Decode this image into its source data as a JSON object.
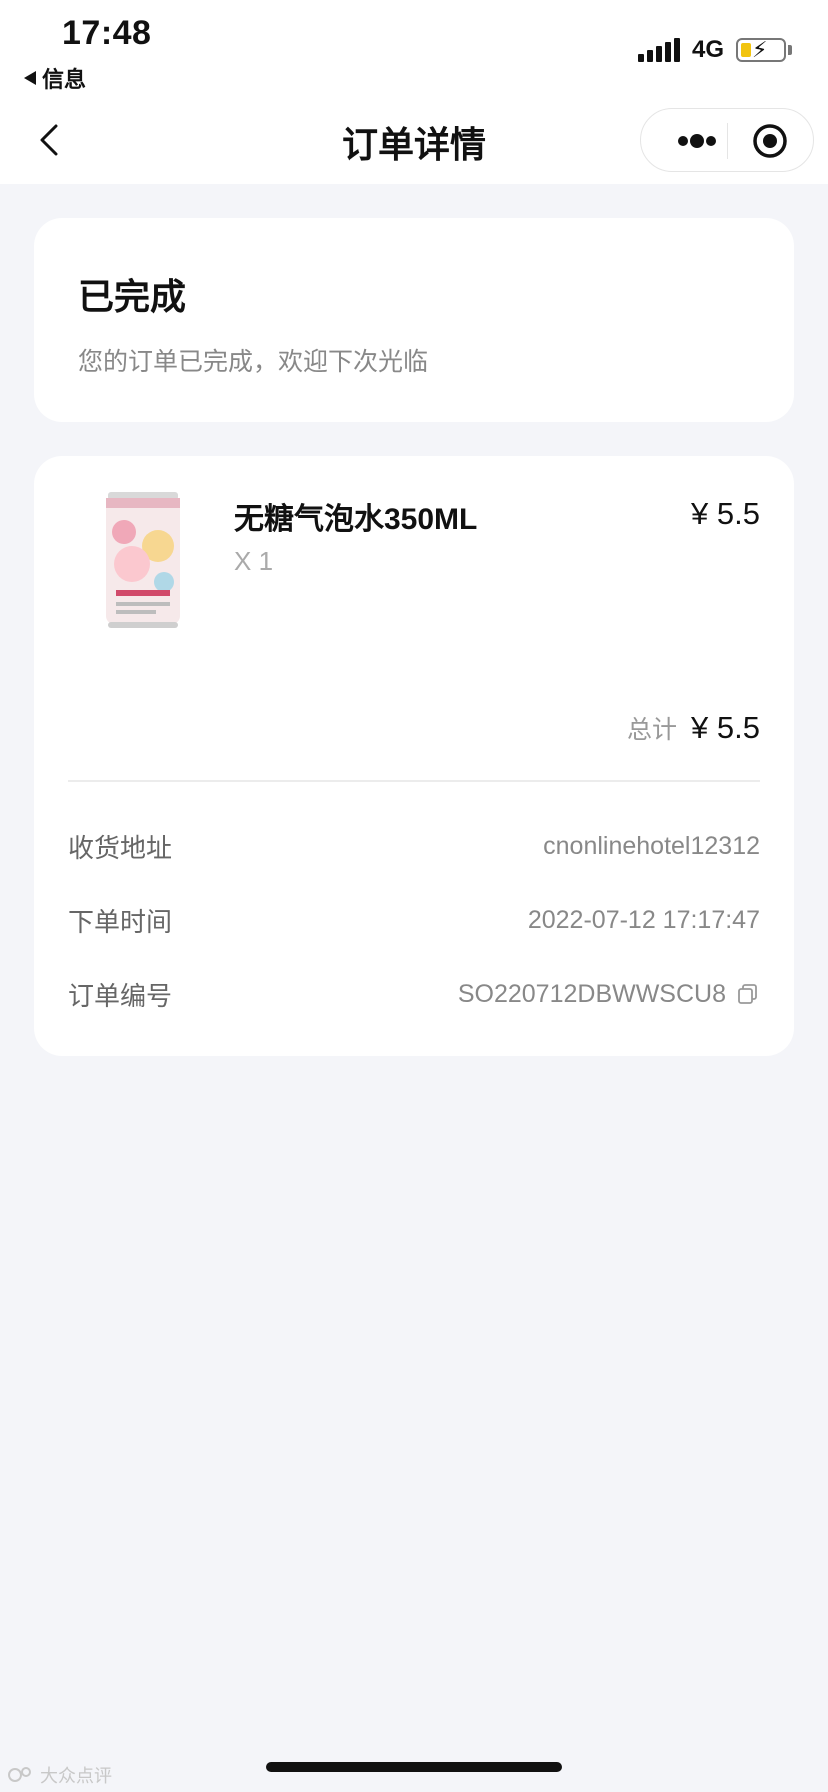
{
  "status_bar": {
    "time": "17:48",
    "back_app": "信息",
    "network": "4G"
  },
  "nav": {
    "title": "订单详情",
    "icons": [
      "chevron-left-icon",
      "more-icon",
      "target-icon"
    ]
  },
  "order_status": {
    "title": "已完成",
    "description": "您的订单已完成，欢迎下次光临"
  },
  "product": {
    "name": "无糖气泡水350ML",
    "quantity": "X 1",
    "price": "¥ 5.5",
    "image_icon": "beverage-can-image"
  },
  "total": {
    "label": "总计",
    "value": "¥ 5.5"
  },
  "info": {
    "address_label": "收货地址",
    "address_value": "cnonlinehotel12312",
    "time_label": "下单时间",
    "time_value": "2022-07-12 17:17:47",
    "order_no_label": "订单编号",
    "order_no_value": "SO220712DBWWSCU8"
  },
  "watermark": "大众点评",
  "colors": {
    "background": "#f4f5f9",
    "card": "#ffffff",
    "muted_text": "#888888",
    "battery": "#f2c40f"
  }
}
